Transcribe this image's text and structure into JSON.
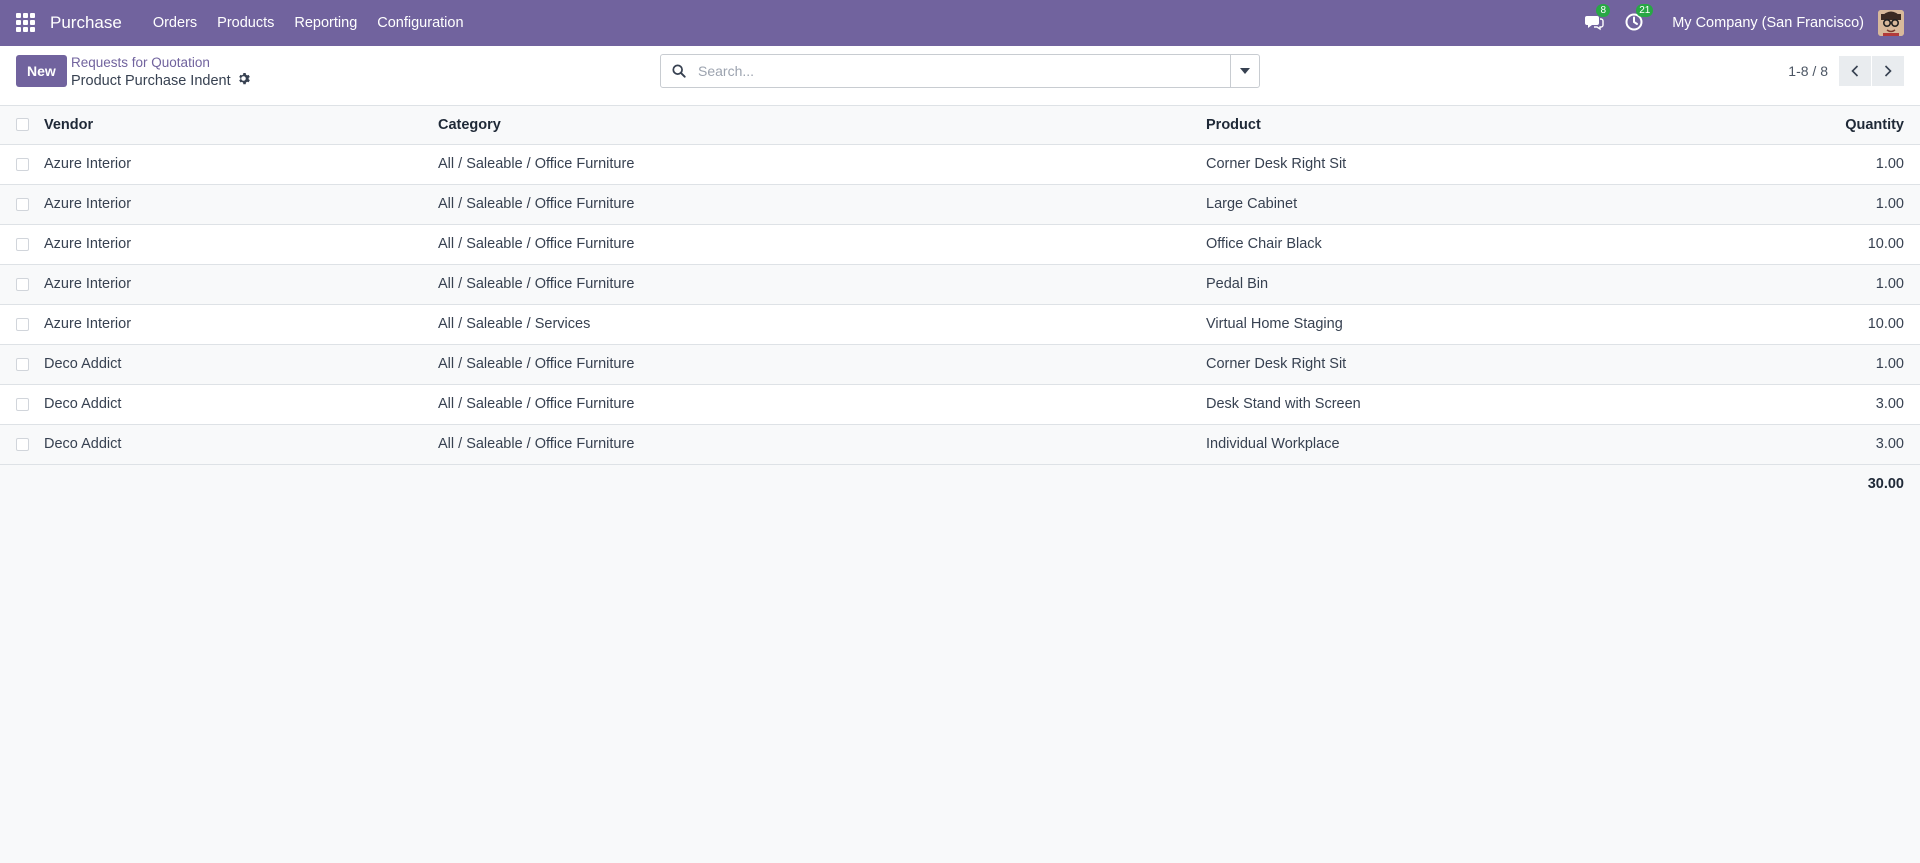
{
  "navbar": {
    "app_name": "Purchase",
    "menu": [
      "Orders",
      "Products",
      "Reporting",
      "Configuration"
    ],
    "messages_badge": "8",
    "activities_badge": "21",
    "company": "My Company (San Francisco)"
  },
  "control_panel": {
    "new_label": "New",
    "breadcrumb_parent": "Requests for Quotation",
    "breadcrumb_current": "Product Purchase Indent",
    "search_placeholder": "Search...",
    "pager_value": "1-8 / 8"
  },
  "table": {
    "headers": {
      "vendor": "Vendor",
      "category": "Category",
      "product": "Product",
      "quantity": "Quantity"
    },
    "rows": [
      {
        "vendor": "Azure Interior",
        "category": "All / Saleable / Office Furniture",
        "product": "Corner Desk Right Sit",
        "quantity": "1.00"
      },
      {
        "vendor": "Azure Interior",
        "category": "All / Saleable / Office Furniture",
        "product": "Large Cabinet",
        "quantity": "1.00"
      },
      {
        "vendor": "Azure Interior",
        "category": "All / Saleable / Office Furniture",
        "product": "Office Chair Black",
        "quantity": "10.00"
      },
      {
        "vendor": "Azure Interior",
        "category": "All / Saleable / Office Furniture",
        "product": "Pedal Bin",
        "quantity": "1.00"
      },
      {
        "vendor": "Azure Interior",
        "category": "All / Saleable / Services",
        "product": "Virtual Home Staging",
        "quantity": "10.00"
      },
      {
        "vendor": "Deco Addict",
        "category": "All / Saleable / Office Furniture",
        "product": "Corner Desk Right Sit",
        "quantity": "1.00"
      },
      {
        "vendor": "Deco Addict",
        "category": "All / Saleable / Office Furniture",
        "product": "Desk Stand with Screen",
        "quantity": "3.00"
      },
      {
        "vendor": "Deco Addict",
        "category": "All / Saleable / Office Furniture",
        "product": "Individual Workplace",
        "quantity": "3.00"
      }
    ],
    "total_quantity": "30.00"
  },
  "colors": {
    "brand": "#71639e",
    "badge": "#28a745"
  },
  "icons": [
    "apps-grid-icon",
    "messages-icon",
    "activities-clock-icon",
    "gear-icon",
    "search-icon",
    "caret-down-icon",
    "chevron-left-icon",
    "chevron-right-icon"
  ]
}
